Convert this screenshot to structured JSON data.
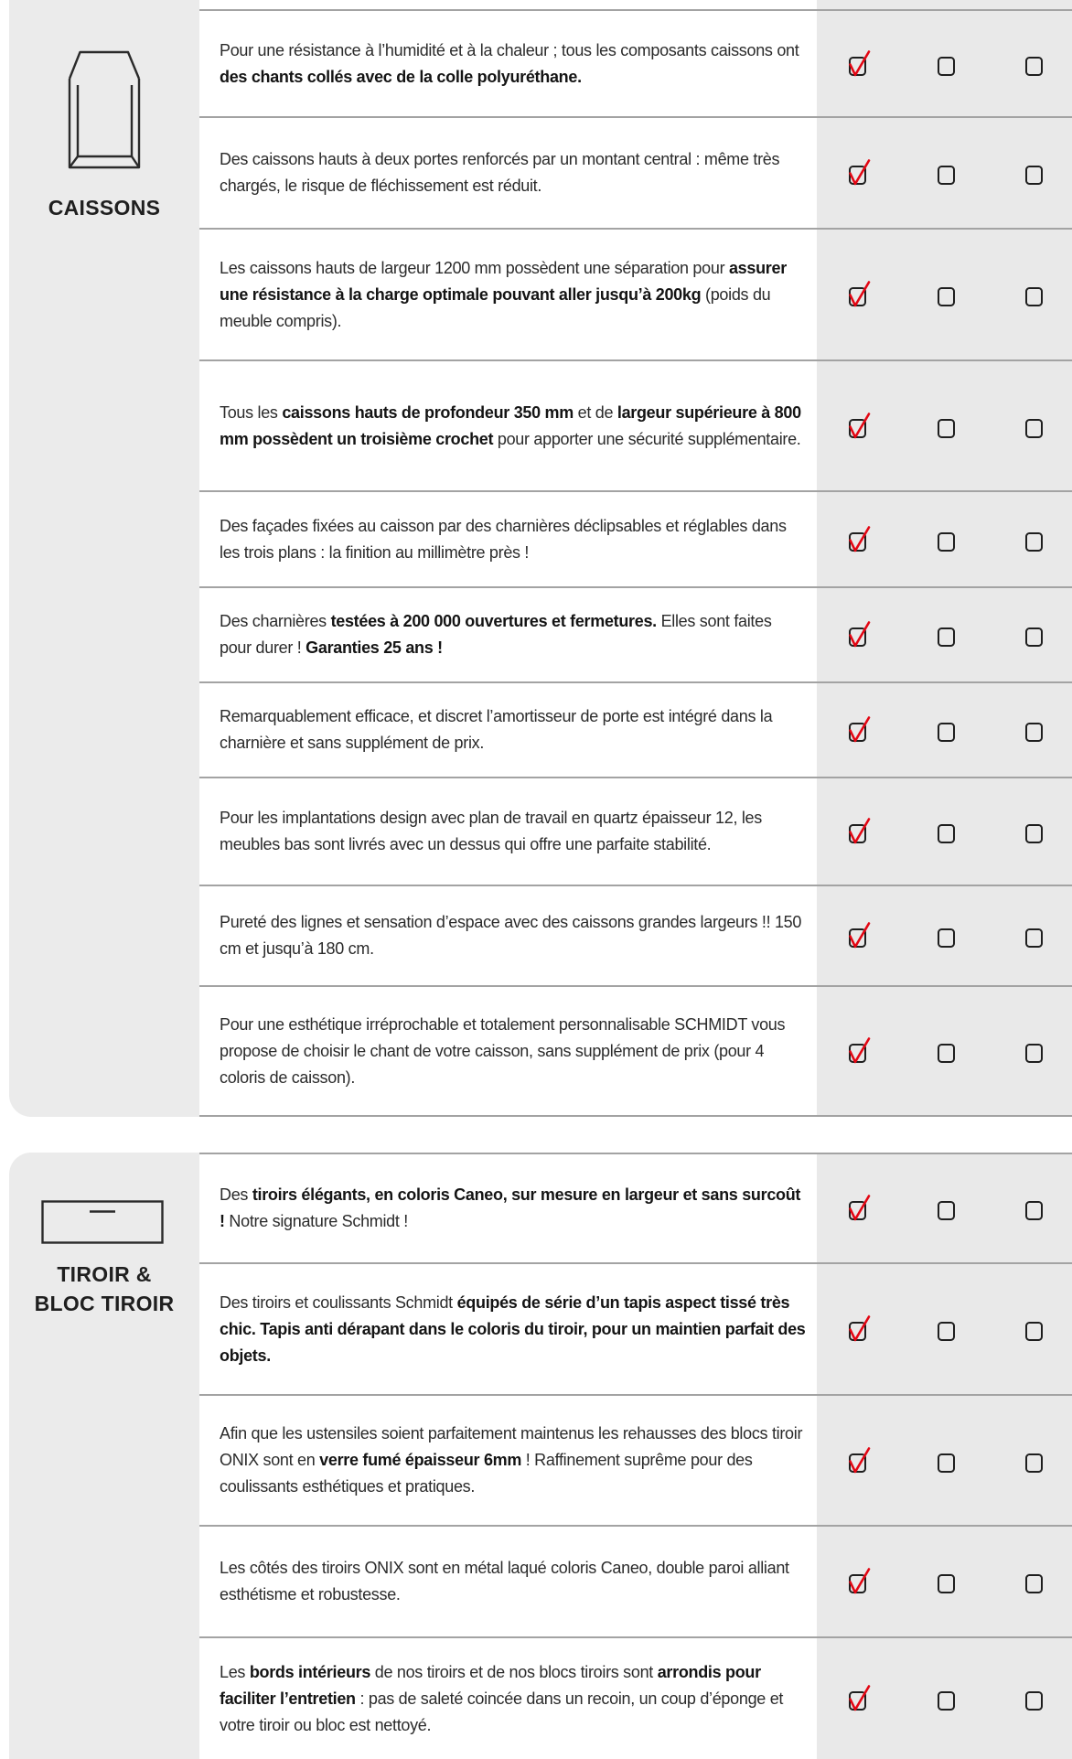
{
  "colors": {
    "check_red": "#e30613",
    "panel_bg": "#ebebeb",
    "column_bg": "#e9e9e9",
    "divider": "#a3a3a3",
    "text": "#2b2b2b"
  },
  "sections": [
    {
      "title_lines": [
        "CAISSONS"
      ],
      "icon": "cabinet-icon",
      "rows": [
        {
          "segments": [
            {
              "text": "Pour une résistance à l’humidité et à la chaleur ; tous les composants caissons ont ",
              "bold": false
            },
            {
              "text": "des chants collés avec de la colle polyuréthane.",
              "bold": true
            }
          ],
          "checks": [
            true,
            false,
            false
          ]
        },
        {
          "segments": [
            {
              "text": "Des caissons hauts à deux portes renforcés par un montant central : même très chargés, le risque de fléchissement est réduit.",
              "bold": false
            }
          ],
          "checks": [
            true,
            false,
            false
          ]
        },
        {
          "segments": [
            {
              "text": "Les caissons hauts de largeur 1200 mm possèdent une séparation pour ",
              "bold": false
            },
            {
              "text": "assurer une résistance à la charge optimale pouvant aller jusqu’à 200kg",
              "bold": true
            },
            {
              "text": " (poids du meuble compris).",
              "bold": false
            }
          ],
          "checks": [
            true,
            false,
            false
          ]
        },
        {
          "segments": [
            {
              "text": "Tous les ",
              "bold": false
            },
            {
              "text": "caissons hauts de profondeur 350 mm",
              "bold": true
            },
            {
              "text": " et de ",
              "bold": false
            },
            {
              "text": "largeur supérieure à 800 mm possèdent un troisième crochet",
              "bold": true
            },
            {
              "text": " pour apporter une sécurité supplémentaire.",
              "bold": false
            }
          ],
          "checks": [
            true,
            false,
            false
          ]
        },
        {
          "segments": [
            {
              "text": "Des façades fixées au caisson par des charnières déclipsables et réglables dans les trois plans : la finition au millimètre près !",
              "bold": false
            }
          ],
          "checks": [
            true,
            false,
            false
          ]
        },
        {
          "segments": [
            {
              "text": "Des charnières ",
              "bold": false
            },
            {
              "text": "testées à 200 000 ouvertures et fermetures.",
              "bold": true
            },
            {
              "text": " Elles sont faites pour durer ! ",
              "bold": false
            },
            {
              "text": "Garanties 25 ans !",
              "bold": true
            }
          ],
          "checks": [
            true,
            false,
            false
          ]
        },
        {
          "segments": [
            {
              "text": "Remarquablement efficace, et discret l’amortisseur de porte est intégré dans la charnière et sans supplément de prix.",
              "bold": false
            }
          ],
          "checks": [
            true,
            false,
            false
          ]
        },
        {
          "segments": [
            {
              "text": "Pour les implantations design avec plan de travail en quartz épaisseur 12, les meubles bas sont livrés avec un dessus qui offre une parfaite stabilité.",
              "bold": false
            }
          ],
          "checks": [
            true,
            false,
            false
          ]
        },
        {
          "segments": [
            {
              "text": "Pureté des lignes et sensation d’espace avec des caissons grandes largeurs !! 150 cm et jusqu’à 180 cm.",
              "bold": false
            }
          ],
          "checks": [
            true,
            false,
            false
          ]
        },
        {
          "segments": [
            {
              "text": "Pour une esthétique irréprochable et totalement personnalisable SCHMIDT vous propose de choisir le chant de votre caisson, sans supplément de prix (pour 4 coloris de caisson).",
              "bold": false
            }
          ],
          "checks": [
            true,
            false,
            false
          ]
        }
      ]
    },
    {
      "title_lines": [
        "TIROIR &",
        "BLOC TIROIR"
      ],
      "icon": "drawer-icon",
      "rows": [
        {
          "segments": [
            {
              "text": "Des ",
              "bold": false
            },
            {
              "text": "tiroirs élégants, en coloris Caneo, sur mesure en largeur et sans surcoût !",
              "bold": true
            },
            {
              "text": " Notre signature Schmidt !",
              "bold": false
            }
          ],
          "checks": [
            true,
            false,
            false
          ]
        },
        {
          "segments": [
            {
              "text": "Des tiroirs et coulissants Schmidt ",
              "bold": false
            },
            {
              "text": "équipés de série d’un tapis aspect tissé très chic. Tapis anti dérapant dans le coloris du tiroir, pour un maintien parfait des objets.",
              "bold": true
            }
          ],
          "checks": [
            true,
            false,
            false
          ]
        },
        {
          "segments": [
            {
              "text": "Afin que les ustensiles soient parfaitement maintenus les rehausses des blocs tiroir ONIX sont en ",
              "bold": false
            },
            {
              "text": "verre fumé épaisseur 6mm",
              "bold": true
            },
            {
              "text": " ! Raffinement suprême pour des coulissants esthétiques et pratiques.",
              "bold": false
            }
          ],
          "checks": [
            true,
            false,
            false
          ]
        },
        {
          "segments": [
            {
              "text": "Les côtés des tiroirs ONIX sont en métal laqué coloris Caneo, double paroi alliant esthétisme et robustesse.",
              "bold": false
            }
          ],
          "checks": [
            true,
            false,
            false
          ]
        },
        {
          "segments": [
            {
              "text": "Les ",
              "bold": false
            },
            {
              "text": "bords intérieurs",
              "bold": true
            },
            {
              "text": " de nos tiroirs et de nos blocs tiroirs sont ",
              "bold": false
            },
            {
              "text": "arrondis pour faciliter l’entretien",
              "bold": true
            },
            {
              "text": " : pas de saleté coincée dans un recoin, un coup d’éponge et votre tiroir ou bloc est nettoyé.",
              "bold": false
            }
          ],
          "checks": [
            true,
            false,
            false
          ]
        }
      ]
    }
  ]
}
